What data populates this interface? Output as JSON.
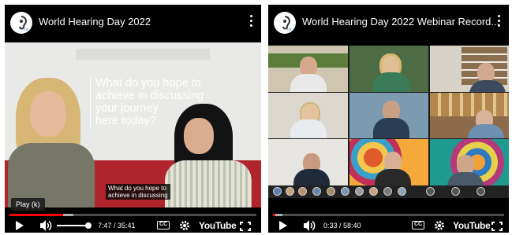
{
  "videos": [
    {
      "title": "World Hearing Day 2022",
      "overlay_quote": [
        "What do you hope to",
        "achieve in discussing",
        "your journey",
        "here today?"
      ],
      "caption": [
        "What do you hope to",
        "achieve in discussing"
      ],
      "tooltip": "Play (k)",
      "time": "7:47 / 35:41",
      "progress": 0.218,
      "cc_label": "CC",
      "brand": "YouTube"
    },
    {
      "title": "World Hearing Day 2022 Webinar Record...",
      "time": "0:33 / 58:40",
      "progress": 0.009,
      "cc_label": "CC",
      "brand": "YouTube"
    }
  ],
  "colors": {
    "progress": "#ff0000",
    "sofa": "#b0242c",
    "player_bg": "#000000"
  },
  "icons": [
    "channel-logo-icon",
    "more-options-icon",
    "play-icon",
    "volume-icon",
    "captions-icon",
    "settings-icon",
    "fullscreen-icon"
  ]
}
